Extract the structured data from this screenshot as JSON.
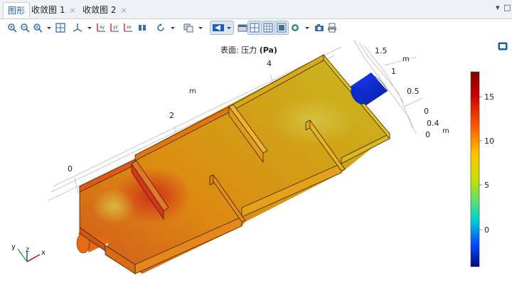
{
  "tabs": [
    {
      "label": "图形",
      "active": true,
      "closable": false
    },
    {
      "label": "收敛图 1",
      "active": false,
      "closable": true
    },
    {
      "label": "收敛图 2",
      "active": false,
      "closable": true
    }
  ],
  "tab_close_glyph": "×",
  "tab_menu_glyph": "▾",
  "window_close_glyph": "□",
  "toolbar_icons": [
    "zoom-in-icon",
    "zoom-out-icon",
    "zoom-box-icon",
    "zoom-extents-icon",
    "axis-orientation-icon",
    "go-to-xy-view-icon",
    "go-to-yz-view-icon",
    "go-to-zx-view-icon",
    "view-icon",
    "rotate-icon",
    "select-all-icon",
    "select-domain-icon",
    "selection-mode-icon",
    "show-grid-icon",
    "show-axis-icon",
    "scene-light-icon",
    "wireframe-icon",
    "transparency-icon",
    "snapshot-icon",
    "print-icon"
  ],
  "plot": {
    "title_prefix": "表面: 压力 ",
    "title_unit": "(Pa)",
    "axis_unit": "m",
    "x_ticks": [
      "0",
      "2",
      "4"
    ],
    "y_ticks": [
      "1.5",
      "1",
      "0.5",
      "0"
    ],
    "z_ticks": [
      "0.4",
      "0"
    ],
    "triad": {
      "x": "x",
      "y": "y",
      "z": "z"
    }
  },
  "colorbar": {
    "ticks": [
      "15",
      "10",
      "5",
      "0"
    ],
    "min": -3.5,
    "max": 18
  },
  "colors": {
    "accent": "#1a5fb4",
    "high": "#b00000",
    "mid": "#d5a015",
    "low": "#0a1d9e"
  }
}
